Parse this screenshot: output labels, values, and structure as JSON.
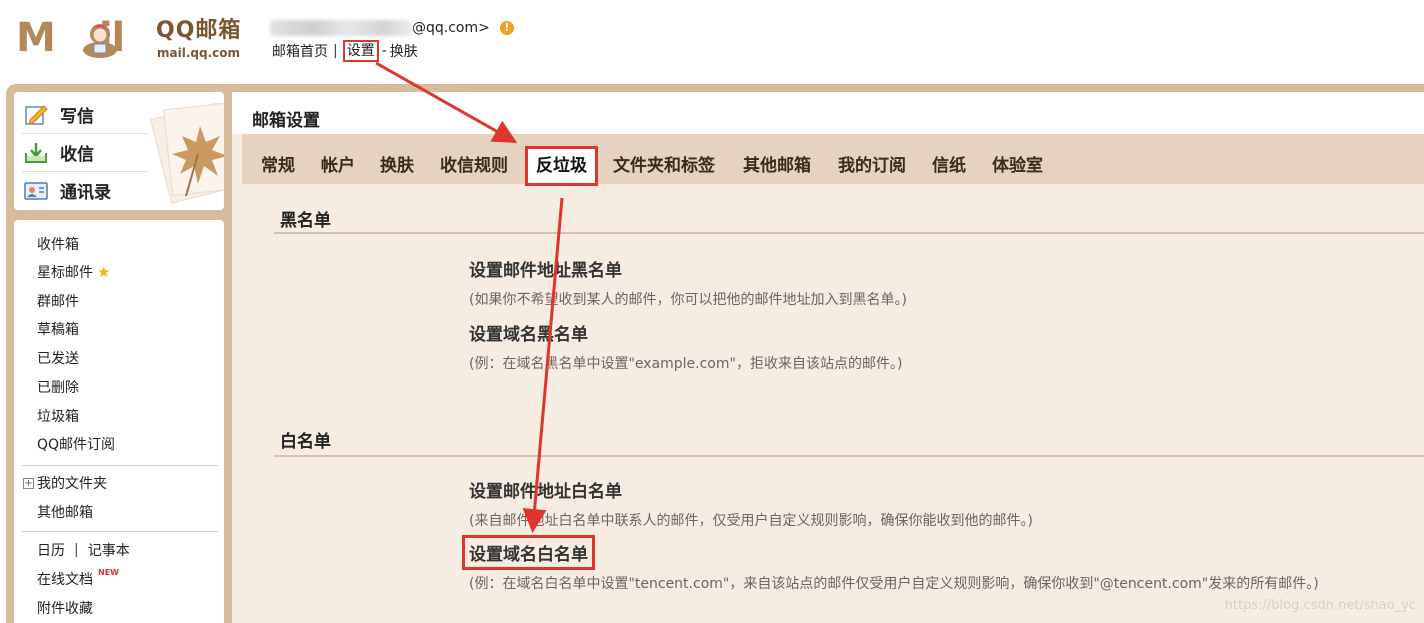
{
  "header": {
    "logo_word": "M",
    "logo_word_tail": "il",
    "logo_brand": "QQ邮箱",
    "logo_domain": "mail.qq.com",
    "account_suffix": "@qq.com>",
    "warning_glyph": "!",
    "nav": {
      "home": "邮箱首页",
      "sep1": "|",
      "settings": "设置",
      "sep2": "-",
      "skin": "换肤"
    }
  },
  "sidebar": {
    "compose": "写信",
    "receive": "收信",
    "contacts": "通讯录",
    "folders": [
      "收件箱",
      "星标邮件",
      "群邮件",
      "草稿箱",
      "已发送",
      "已删除",
      "垃圾箱",
      "QQ邮件订阅"
    ],
    "my_folders": "我的文件夹",
    "plus_glyph": "+",
    "other_mailboxes": "其他邮箱",
    "calendar": "日历",
    "tools_sep": "|",
    "notebook": "记事本",
    "online_docs": "在线文档",
    "new_badge": "NEW",
    "attachments": "附件收藏"
  },
  "main": {
    "title": "邮箱设置",
    "tabs": [
      "常规",
      "帐户",
      "换肤",
      "收信规则",
      "反垃圾",
      "文件夹和标签",
      "其他邮箱",
      "我的订阅",
      "信纸",
      "体验室"
    ],
    "active_tab": "反垃圾",
    "blacklist": {
      "title": "黑名单",
      "address_title": "设置邮件地址黑名单",
      "address_desc": "(如果你不希望收到某人的邮件，你可以把他的邮件地址加入到黑名单。)",
      "domain_title": "设置域名黑名单",
      "domain_desc": "(例：在域名黑名单中设置\"example.com\"，拒收来自该站点的邮件。)"
    },
    "whitelist": {
      "title": "白名单",
      "address_title": "设置邮件地址白名单",
      "address_desc": "(来自邮件地址白名单中联系人的邮件，仅受用户自定义规则影响，确保你能收到他的邮件。)",
      "domain_title": "设置域名白名单",
      "domain_desc": "(例：在域名白名单中设置\"tencent.com\"，来自该站点的邮件仅受用户自定义规则影响，确保你收到\"@tencent.com\"发来的所有邮件。)"
    }
  },
  "watermark": "https://blog.csdn.net/shao_yc",
  "colors": {
    "brand_tan": "#b5885a",
    "frame": "#d6bc9c",
    "tabbar": "#e6d2bf",
    "content_bg": "#f6ece2",
    "highlight_red": "#e0342c",
    "star": "#f4b31a"
  },
  "icons": [
    "mascot-icon",
    "compose-icon",
    "receive-icon",
    "contacts-icon",
    "maple-leaf-decoration",
    "star-icon",
    "warning-icon",
    "expand-plus-icon"
  ]
}
